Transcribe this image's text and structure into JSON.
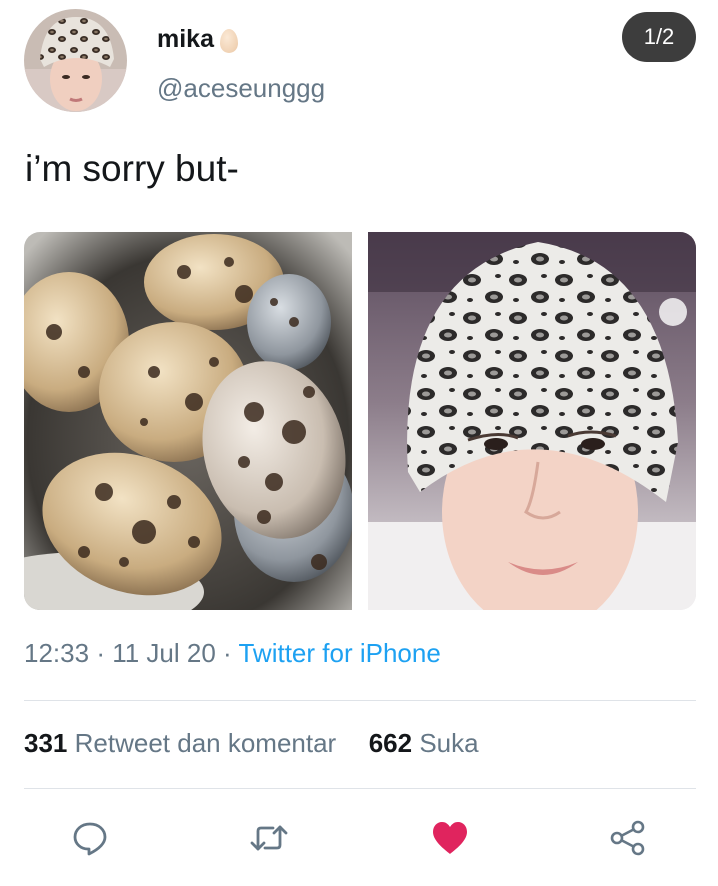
{
  "tweet": {
    "display_name": "mika",
    "name_emoji": "egg-icon",
    "handle": "@aceseunggg",
    "counter": "1/2",
    "text": "i’m sorry but-",
    "time": "12:33",
    "date": "11 Jul 20",
    "source": "Twitter for iPhone",
    "separator": "·"
  },
  "stats": {
    "retweets_count": "331",
    "retweets_label": "Retweet dan komentar",
    "likes_count": "662",
    "likes_label": "Suka"
  },
  "actions": [
    {
      "name": "reply",
      "icon": "speech-bubble-icon"
    },
    {
      "name": "retweet",
      "icon": "retweet-icon"
    },
    {
      "name": "like",
      "icon": "heart-icon",
      "active": true
    },
    {
      "name": "share",
      "icon": "share-icon"
    }
  ],
  "colors": {
    "link": "#1da1f2",
    "secondary_text": "#657786",
    "like_active": "#e0245e",
    "icon": "#657786",
    "counter_bg": "#3d3d3d"
  }
}
